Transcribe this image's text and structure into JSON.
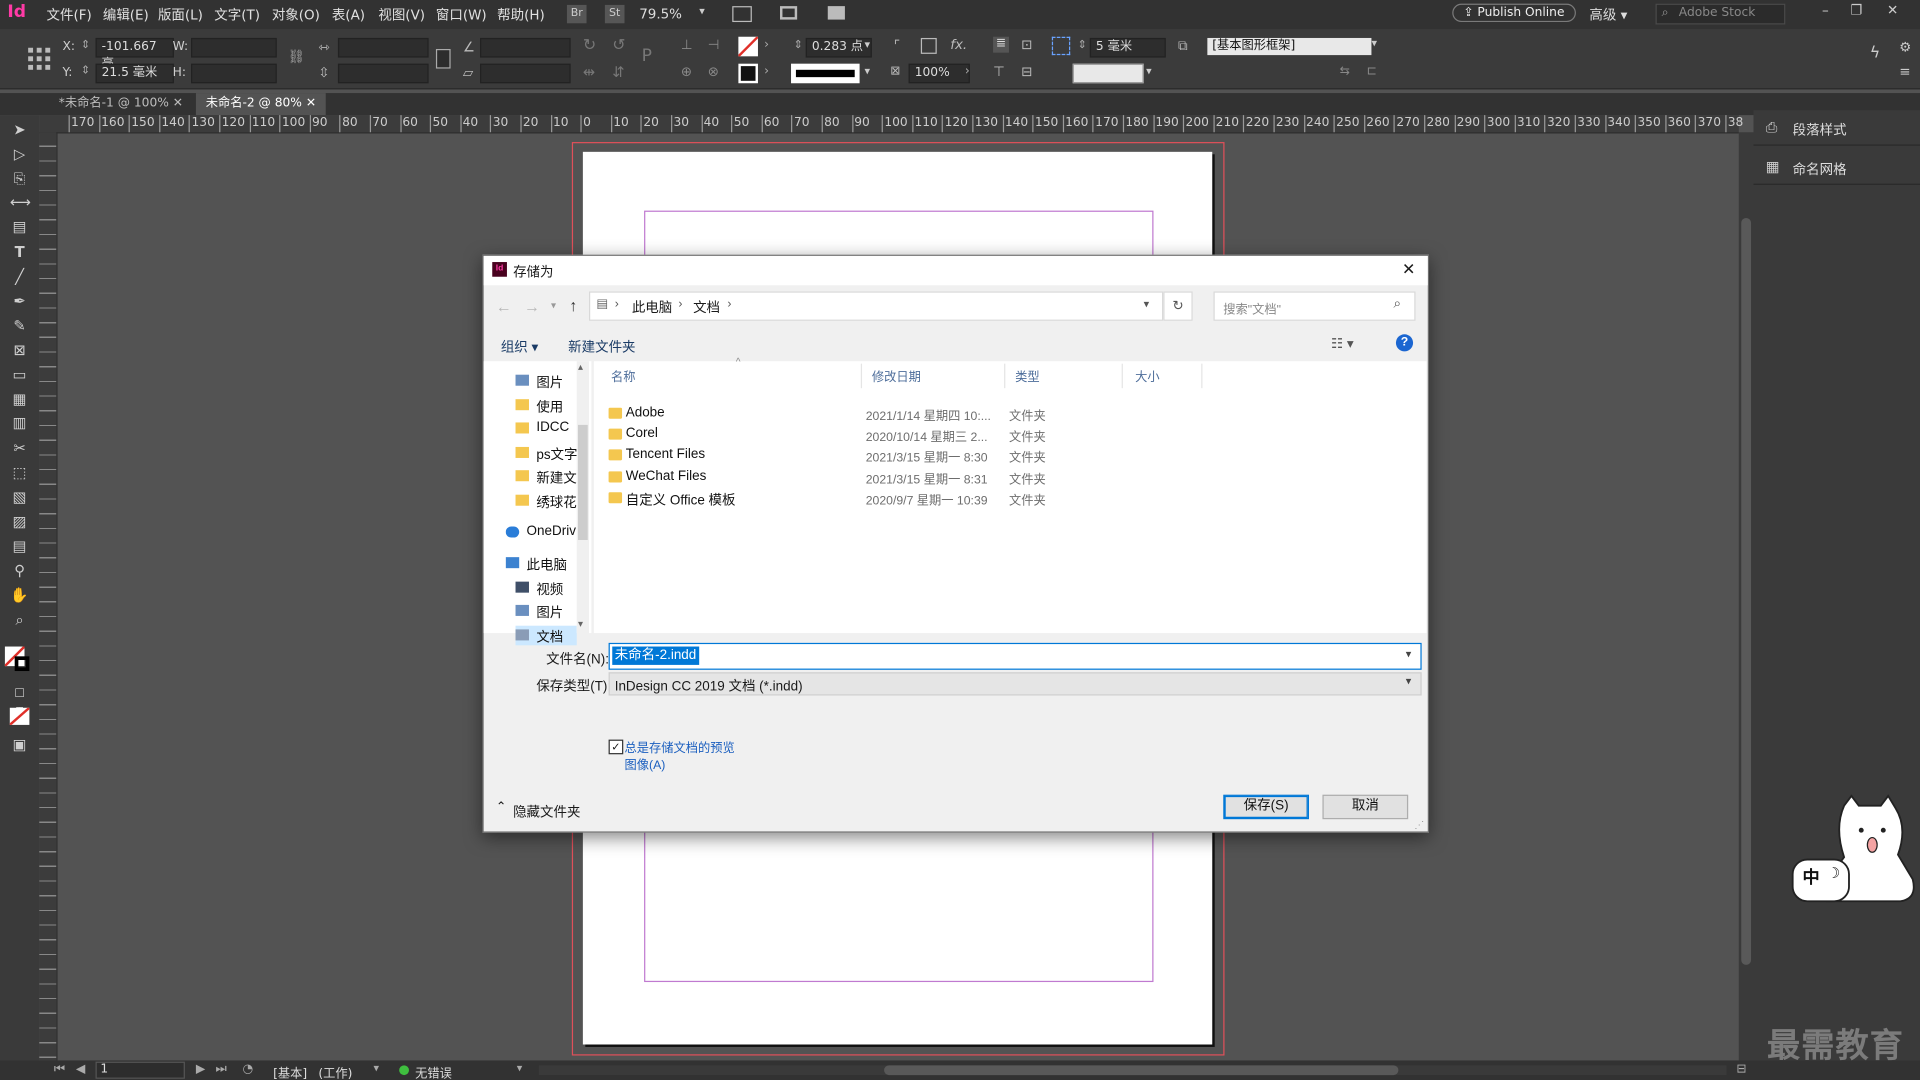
{
  "app": {
    "logo": "Id",
    "accent": "#ff3aa6"
  },
  "menu": [
    "文件(F)",
    "编辑(E)",
    "版面(L)",
    "文字(T)",
    "对象(O)",
    "表(A)",
    "视图(V)",
    "窗口(W)",
    "帮助(H)"
  ],
  "menu_extra": {
    "br": "Br",
    "st": "St",
    "zoom": "79.5%",
    "publish": "Publish Online",
    "workspace": "高级",
    "search_placeholder": "Adobe Stock"
  },
  "control": {
    "x_label": "X:",
    "x_value": "-101.667 毫",
    "y_label": "Y:",
    "y_value": "21.5 毫米",
    "w_label": "W:",
    "h_label": "H:",
    "stroke_weight": "0.283 点",
    "opacity": "100%",
    "gap": "5 毫米",
    "object_style": "[基本图形框架]"
  },
  "tabs": [
    {
      "label": "*未命名-1 @ 100%",
      "active": false
    },
    {
      "label": "未命名-2 @ 80%",
      "active": true
    }
  ],
  "ruler_marks": [
    "170",
    "160",
    "150",
    "140",
    "130",
    "120",
    "110",
    "100",
    "90",
    "80",
    "70",
    "60",
    "50",
    "40",
    "30",
    "20",
    "10",
    "0",
    "10",
    "20",
    "30",
    "40",
    "50",
    "60",
    "70",
    "80",
    "90",
    "100",
    "110",
    "120",
    "130",
    "140",
    "150",
    "160",
    "170",
    "180",
    "190",
    "200",
    "210",
    "220",
    "230",
    "240",
    "250",
    "260",
    "270",
    "280",
    "290",
    "300",
    "310",
    "320",
    "330",
    "340",
    "350",
    "360",
    "370",
    "38"
  ],
  "panels": [
    {
      "label": "段落样式"
    },
    {
      "label": "命名网格"
    }
  ],
  "dialog": {
    "title": "存储为",
    "path": [
      "此电脑",
      "文档"
    ],
    "search_placeholder": "搜索\"文档\"",
    "organize": "组织 ▾",
    "new_folder": "新建文件夹",
    "columns": [
      "名称",
      "修改日期",
      "类型",
      "大小"
    ],
    "files": [
      {
        "name": "Adobe",
        "date": "2021/1/14 星期四 10:...",
        "type": "文件夹"
      },
      {
        "name": "Corel",
        "date": "2020/10/14 星期三 2...",
        "type": "文件夹"
      },
      {
        "name": "Tencent Files",
        "date": "2021/3/15 星期一 8:30",
        "type": "文件夹"
      },
      {
        "name": "WeChat Files",
        "date": "2021/3/15 星期一 8:31",
        "type": "文件夹"
      },
      {
        "name": "自定义 Office 模板",
        "date": "2020/9/7 星期一 10:39",
        "type": "文件夹"
      }
    ],
    "nav": [
      {
        "label": "图片",
        "icon": "picture"
      },
      {
        "label": "使用",
        "icon": "folder"
      },
      {
        "label": "IDCC",
        "icon": "folder"
      },
      {
        "label": "ps文字",
        "icon": "folder"
      },
      {
        "label": "新建文",
        "icon": "folder"
      },
      {
        "label": "绣球花",
        "icon": "folder"
      },
      {
        "label": "OneDriv",
        "icon": "cloud"
      },
      {
        "label": "此电脑",
        "icon": "computer"
      },
      {
        "label": "视频",
        "icon": "video"
      },
      {
        "label": "图片",
        "icon": "picture"
      },
      {
        "label": "文档",
        "icon": "doc"
      }
    ],
    "filename_label": "文件名(N):",
    "filename": "未命名-2.indd",
    "type_label": "保存类型(T):",
    "type_value": "InDesign CC 2019 文档 (*.indd)",
    "checkbox_line1": "总是存储文档的预览",
    "checkbox_line2": "图像(A)",
    "checkbox_checked": true,
    "hide_folders": "隐藏文件夹",
    "save": "保存(S)",
    "cancel": "取消"
  },
  "status": {
    "page": "1",
    "mode": "[基本]",
    "work": "(工作)",
    "errors": "无错误",
    "ok_color": "#3fbf3f"
  },
  "ime": {
    "label": "中"
  },
  "watermark": "最需教育"
}
